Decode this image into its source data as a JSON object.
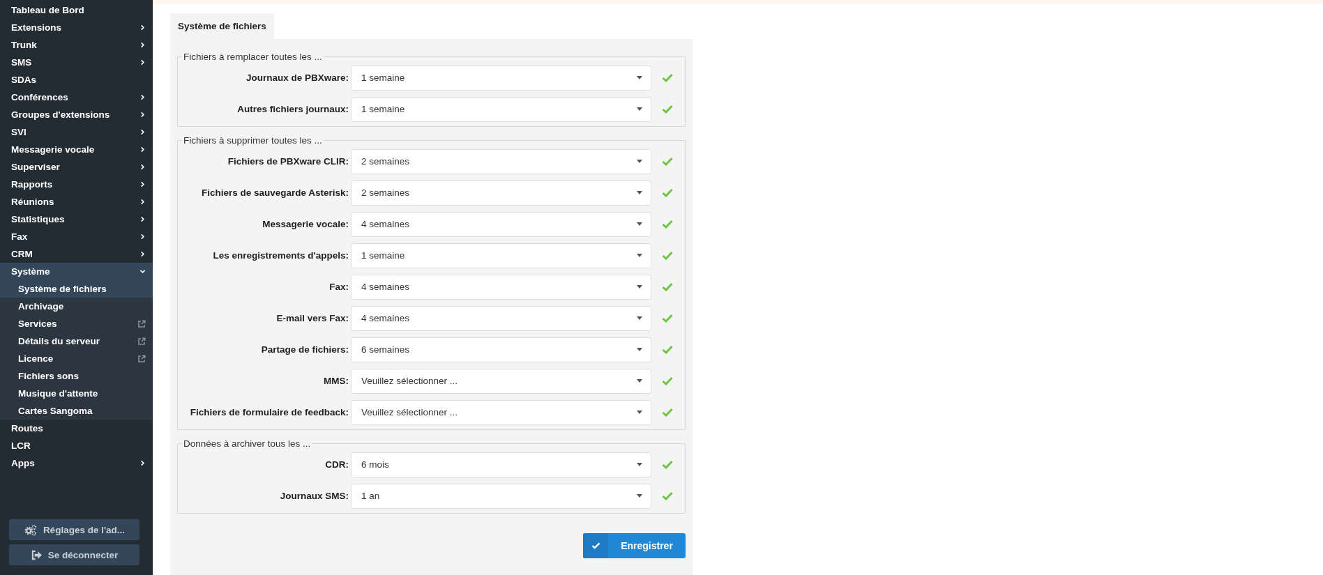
{
  "sidebar": {
    "items": [
      {
        "label": "Tableau de Bord",
        "kind": "link"
      },
      {
        "label": "Extensions",
        "kind": "submenu",
        "expanded": false
      },
      {
        "label": "Trunk",
        "kind": "submenu",
        "expanded": false
      },
      {
        "label": "SMS",
        "kind": "submenu",
        "expanded": false
      },
      {
        "label": "SDAs",
        "kind": "link"
      },
      {
        "label": "Conférences",
        "kind": "submenu",
        "expanded": false
      },
      {
        "label": "Groupes d'extensions",
        "kind": "submenu",
        "expanded": false
      },
      {
        "label": "SVI",
        "kind": "submenu",
        "expanded": false
      },
      {
        "label": "Messagerie vocale",
        "kind": "submenu",
        "expanded": false
      },
      {
        "label": "Superviser",
        "kind": "submenu",
        "expanded": false
      },
      {
        "label": "Rapports",
        "kind": "submenu",
        "expanded": false
      },
      {
        "label": "Réunions",
        "kind": "submenu",
        "expanded": false
      },
      {
        "label": "Statistiques",
        "kind": "submenu",
        "expanded": false
      },
      {
        "label": "Fax",
        "kind": "submenu",
        "expanded": false
      },
      {
        "label": "CRM",
        "kind": "submenu",
        "expanded": false
      },
      {
        "label": "Système",
        "kind": "submenu",
        "expanded": true,
        "children": [
          {
            "label": "Système de fichiers",
            "selected": true,
            "external": false
          },
          {
            "label": "Archivage",
            "selected": false,
            "external": false
          },
          {
            "label": "Services",
            "selected": false,
            "external": true
          },
          {
            "label": "Détails du serveur",
            "selected": false,
            "external": true
          },
          {
            "label": "Licence",
            "selected": false,
            "external": true
          },
          {
            "label": "Fichiers sons",
            "selected": false,
            "external": false
          },
          {
            "label": "Musique d'attente",
            "selected": false,
            "external": false
          },
          {
            "label": "Cartes Sangoma",
            "selected": false,
            "external": false
          }
        ]
      },
      {
        "label": "Routes",
        "kind": "link"
      },
      {
        "label": "LCR",
        "kind": "link"
      },
      {
        "label": "Apps",
        "kind": "submenu",
        "expanded": false
      }
    ],
    "buttons": [
      {
        "label": "Réglages de l'ad...",
        "kind": "settings"
      },
      {
        "label": "Se déconnecter",
        "kind": "logout"
      }
    ]
  },
  "tabs": [
    {
      "label": "Système de fichiers",
      "selected": true
    }
  ],
  "sections": [
    {
      "legend": "Fichiers à remplacer toutes les ...",
      "fields": [
        {
          "label": "Journaux de PBXware:",
          "value": "1 semaine",
          "valid": true
        },
        {
          "label": "Autres fichiers journaux:",
          "value": "1 semaine",
          "valid": true
        }
      ]
    },
    {
      "legend": "Fichiers à supprimer toutes les ...",
      "fields": [
        {
          "label": "Fichiers de PBXware CLIR:",
          "value": "2 semaines",
          "valid": true
        },
        {
          "label": "Fichiers de sauvegarde Asterisk:",
          "value": "2 semaines",
          "valid": true
        },
        {
          "label": "Messagerie vocale:",
          "value": "4 semaines",
          "valid": true
        },
        {
          "label": "Les enregistrements d'appels:",
          "value": "1 semaine",
          "valid": true
        },
        {
          "label": "Fax:",
          "value": "4 semaines",
          "valid": true
        },
        {
          "label": "E-mail vers Fax:",
          "value": "4 semaines",
          "valid": true
        },
        {
          "label": "Partage de fichiers:",
          "value": "6 semaines",
          "valid": true
        },
        {
          "label": "MMS:",
          "placeholder": "Veuillez sélectionner ...",
          "valid": true
        },
        {
          "label": "Fichiers de formulaire de feedback:",
          "placeholder": "Veuillez sélectionner ...",
          "valid": true
        }
      ]
    },
    {
      "legend": "Données à archiver tous les ...",
      "fields": [
        {
          "label": "CDR:",
          "value": "6 mois",
          "valid": true
        },
        {
          "label": "Journaux SMS:",
          "value": "1 an",
          "valid": true
        }
      ]
    }
  ],
  "save_button": {
    "label": "Enregistrer"
  }
}
